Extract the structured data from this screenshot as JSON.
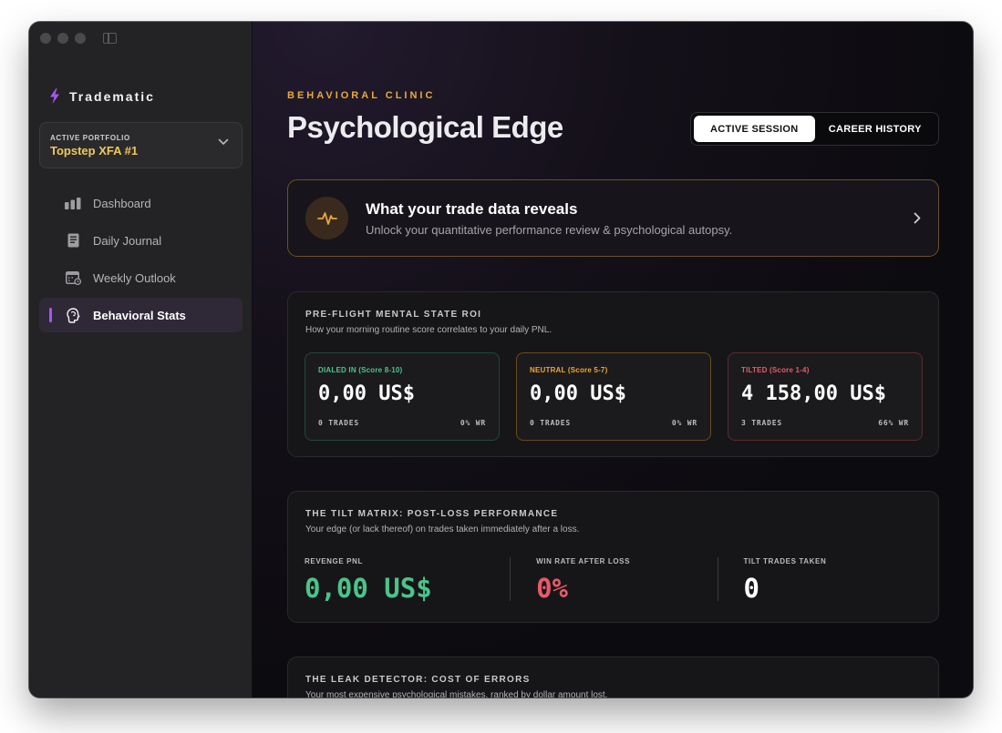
{
  "sidebar": {
    "brand": "Tradematic",
    "portfolio": {
      "label": "ACTIVE PORTFOLIO",
      "value": "Topstep XFA #1"
    },
    "items": [
      {
        "label": "Dashboard",
        "icon": "bar-chart-icon"
      },
      {
        "label": "Daily Journal",
        "icon": "journal-icon"
      },
      {
        "label": "Weekly Outlook",
        "icon": "calendar-icon"
      },
      {
        "label": "Behavioral Stats",
        "icon": "brain-icon",
        "active": true
      }
    ]
  },
  "header": {
    "eyebrow": "BEHAVIORAL CLINIC",
    "title": "Psychological Edge",
    "tabs": [
      {
        "label": "ACTIVE SESSION",
        "active": true
      },
      {
        "label": "CAREER HISTORY",
        "active": false
      }
    ]
  },
  "reveal": {
    "title": "What your trade data reveals",
    "subtitle": "Unlock your quantitative performance review & psychological autopsy."
  },
  "mindset": {
    "title": "PRE-FLIGHT MENTAL STATE ROI",
    "subtitle": "How your morning routine score correlates to your daily PNL.",
    "tiles": [
      {
        "label": "DIALED IN (Score 8-10)",
        "value": "0,00 US$",
        "trades": "0 TRADES",
        "wr": "0% WR",
        "color": "#4cc38a"
      },
      {
        "label": "NEUTRAL (Score 5-7)",
        "value": "0,00 US$",
        "trades": "0 TRADES",
        "wr": "0% WR",
        "color": "#f0a53a"
      },
      {
        "label": "TILTED (Score 1-4)",
        "value": "4 158,00 US$",
        "trades": "3 TRADES",
        "wr": "66% WR",
        "color": "#e85a68"
      }
    ]
  },
  "tilt": {
    "title": "THE TILT MATRIX: POST-LOSS PERFORMANCE",
    "subtitle": "Your edge (or lack thereof) on trades taken immediately after a loss.",
    "stats": [
      {
        "label": "REVENGE PNL",
        "value": "0,00 US$",
        "color": "#4cc38a"
      },
      {
        "label": "WIN RATE AFTER LOSS",
        "value": "0%",
        "color": "#e85a68"
      },
      {
        "label": "TILT TRADES TAKEN",
        "value": "0",
        "color": "#ffffff"
      }
    ]
  },
  "leak": {
    "title": "THE LEAK DETECTOR: COST OF ERRORS",
    "subtitle": "Your most expensive psychological mistakes, ranked by dollar amount lost."
  },
  "colors": {
    "accent": "#a557ef",
    "gold": "#e8a93a",
    "portfolio": "#f0c85a"
  }
}
